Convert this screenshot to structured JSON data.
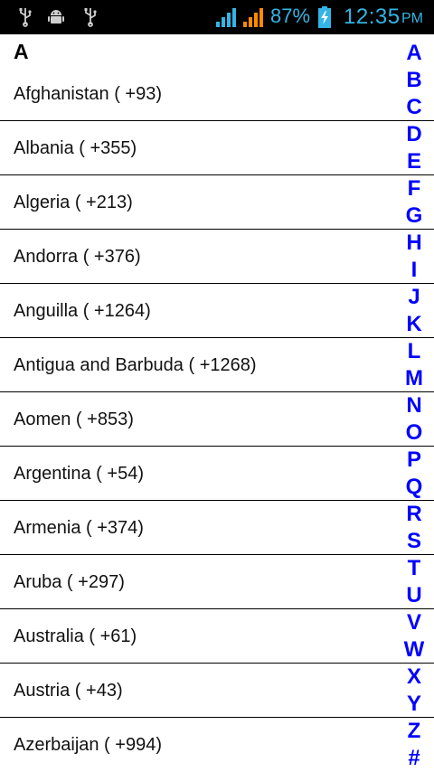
{
  "status_bar": {
    "battery_percent": "87%",
    "time": "12:35",
    "ampm": "PM",
    "icons": [
      "usb-icon",
      "android-debug-icon",
      "usb-icon",
      "signal-icon",
      "signal-icon",
      "battery-charging-icon"
    ],
    "accent_color": "#33b5e5"
  },
  "list": {
    "section_header": "A",
    "rows": [
      "Afghanistan ( +93)",
      "Albania ( +355)",
      "Algeria ( +213)",
      "Andorra ( +376)",
      "Anguilla ( +1264)",
      "Antigua and Barbuda ( +1268)",
      "Aomen ( +853)",
      "Argentina ( +54)",
      "Armenia ( +374)",
      "Aruba ( +297)",
      "Australia ( +61)",
      "Austria ( +43)",
      "Azerbaijan ( +994)"
    ]
  },
  "index_bar": {
    "letters": [
      "A",
      "B",
      "C",
      "D",
      "E",
      "F",
      "G",
      "H",
      "I",
      "J",
      "K",
      "L",
      "M",
      "N",
      "O",
      "P",
      "Q",
      "R",
      "S",
      "T",
      "U",
      "V",
      "W",
      "X",
      "Y",
      "Z",
      "#"
    ],
    "color": "#0000ff"
  }
}
